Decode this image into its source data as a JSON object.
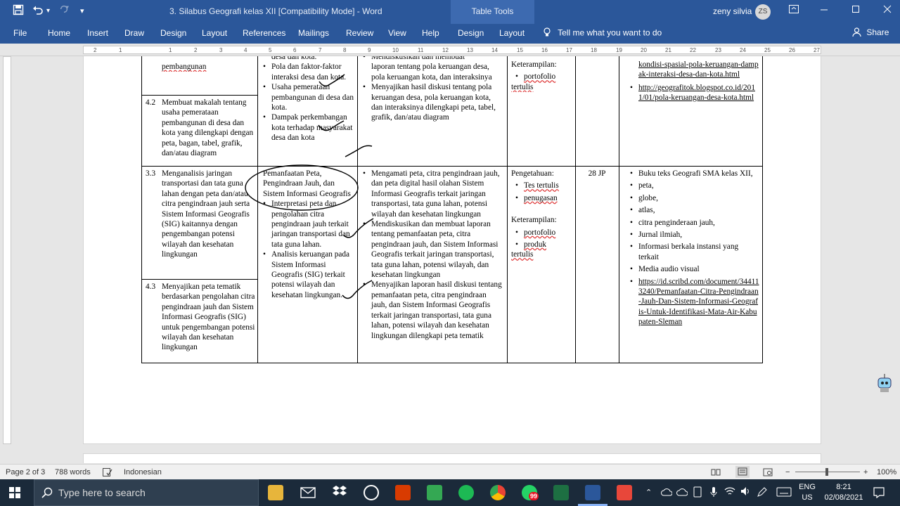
{
  "titlebar": {
    "doc_title": "3. Silabus Geografi kelas XII [Compatibility Mode]  -  Word",
    "context_tab": "Table Tools",
    "user_name": "zeny silvia",
    "user_initials": "ZS"
  },
  "ribbon": {
    "tabs": [
      "File",
      "Home",
      "Insert",
      "Draw",
      "Design",
      "Layout",
      "References",
      "Mailings",
      "Review",
      "View",
      "Help",
      "Design",
      "Layout"
    ],
    "tell_me": "Tell me what you want to do",
    "share": "Share"
  },
  "ruler": {
    "marks": [
      "2",
      "1",
      "1",
      "2",
      "3",
      "4",
      "5",
      "6",
      "7",
      "8",
      "9",
      "10",
      "11",
      "12",
      "13",
      "14",
      "15",
      "16",
      "17",
      "18",
      "19",
      "20",
      "21",
      "22",
      "23",
      "24",
      "25",
      "26",
      "27"
    ]
  },
  "table": {
    "row1": {
      "col1_cont": "pembangunan",
      "col2_items": [
        "Pola dan faktor-faktor interaksi desa dan kota.",
        "Usaha pemerataan pembangunan di desa dan kota.",
        "Dampak perkembangan kota terhadap masyarakat desa dan kota"
      ],
      "col2_partial": "desa dan kota.",
      "col3_partial": "Mendiskusikan dan membuat",
      "col3_items": [
        "laporan tentang pola keruangan desa, pola keruangan kota, dan interaksinya",
        "Menyajikan hasil diskusi tentang pola keruangan desa, pola keruangan kota, dan interaksinya dilengkapi peta, tabel, grafik, dan/atau diagram"
      ],
      "col4_heading": "Keterampilan:",
      "col4_items": [
        "portofolio"
      ],
      "col4_tail": "tertulis",
      "col6_partial": "kondisi-spasial-pola-keruangan-dampak-interaksi-desa-dan-kota.html",
      "col6_items": [
        "http://geografitok.blogspot.co.id/2011/01/pola-keruangan-desa-kota.html"
      ],
      "kd_num": "4.2",
      "kd_text": "Membuat makalah tentang usaha pemerataan pembangunan di desa dan kota yang dilengkapi dengan peta, bagan, tabel, grafik, dan/atau diagram"
    },
    "row2": {
      "kd_num": "3.3",
      "kd_text": "Menganalisis jaringan transportasi dan tata guna lahan dengan peta dan/atau citra pengindraan jauh serta Sistem Informasi Geografis (SIG) kaitannya dengan pengembangan potensi wilayah dan kesehatan lingkungan",
      "col2_first": "Pemanfaatan Peta, Pengindraan Jauh, dan Sistem Informasi Geografis",
      "col2_items": [
        "Interpretasi peta dan pengolahan citra pengindraan jauh terkait jaringan transportasi dan tata guna lahan.",
        "Analisis keruangan pada Sistem Informasi Geografis (SIG) terkait potensi wilayah dan kesehatan lingkungan."
      ],
      "col3_items": [
        "Mengamati peta, citra pengindraan jauh, dan peta digital hasil olahan Sistem Informasi Geografis terkait jaringan transportasi, tata guna lahan, potensi wilayah dan kesehatan lingkungan",
        "Mendiskusikan dan membuat laporan tentang pemanfaatan peta, citra pengindraan jauh, dan Sistem Informasi Geografis terkait jaringan transportasi, tata guna lahan, potensi wilayah, dan kesehatan lingkungan",
        "Menyajikan laporan hasil diskusi tentang pemanfaatan peta, citra pengindraan jauh, dan Sistem Informasi Geografis terkait jaringan transportasi, tata guna lahan, potensi wilayah dan kesehatan lingkungan dilengkapi peta tematik"
      ],
      "col4_heading1": "Pengetahuan:",
      "col4_items1": [
        "Tes tertulis",
        "penugasan"
      ],
      "col4_heading2": "Keterampilan:",
      "col4_items2": [
        "portofolio",
        "produk"
      ],
      "col4_tail": "tertulis",
      "col5": "28 JP",
      "col6_items": [
        "Buku teks Geografi SMA kelas XII,",
        "peta,",
        "globe,",
        "atlas,",
        "citra penginderaan jauh,",
        "Jurnal ilmiah,",
        "Informasi berkala instansi yang terkait",
        "Media audio visual"
      ],
      "col6_link": "https://id.scribd.com/document/344113240/Pemanfaatan-Citra-Pengindraan-Jauh-Dan-Sistem-Informasi-Geografis-Untuk-Identifikasi-Mata-Air-Kabupaten-Sleman"
    },
    "row3": {
      "kd_num": "4.3",
      "kd_text": "Menyajikan peta tematik berdasarkan pengolahan citra pengindraan jauh dan Sistem Informasi Geografis (SIG) untuk pengembangan potensi wilayah dan kesehatan lingkungan"
    }
  },
  "statusbar": {
    "page": "Page 2 of 3",
    "words": "788 words",
    "language": "Indonesian",
    "zoom": "100%"
  },
  "taskbar": {
    "search_placeholder": "Type here to search",
    "whatsapp_badge": "99",
    "lang_top": "ENG",
    "lang_bottom": "US",
    "time": "8:21",
    "date": "02/08/2021"
  },
  "colors": {
    "word_blue": "#2b579a",
    "taskbar": "#1b2a3a"
  }
}
